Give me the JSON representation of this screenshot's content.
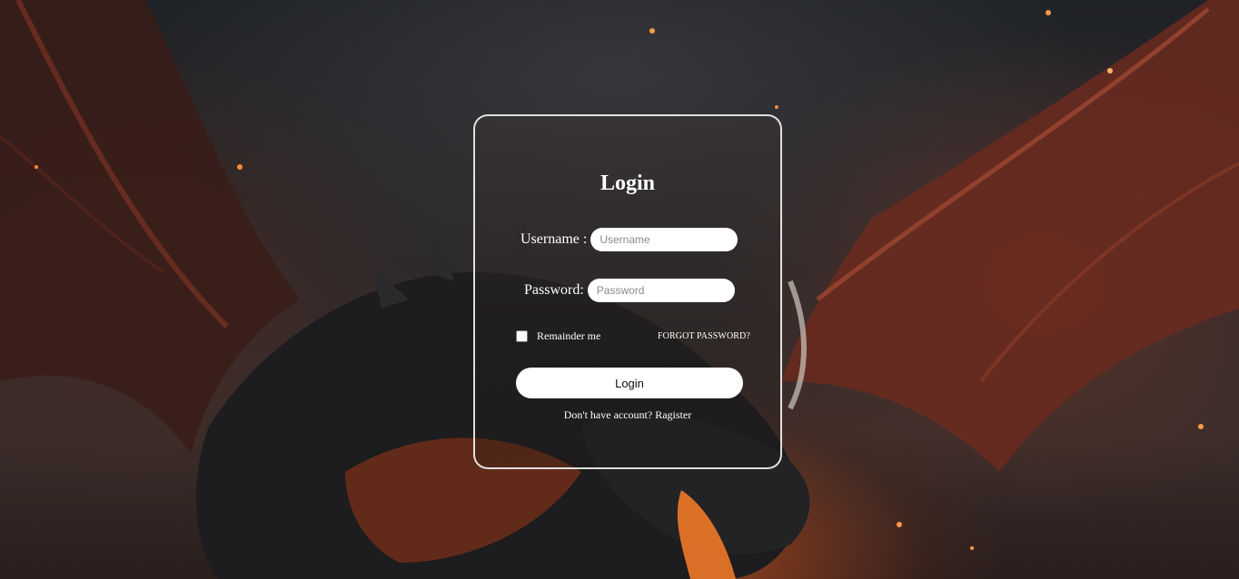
{
  "login_form": {
    "title": "Login",
    "username_label": "Username :",
    "username_placeholder": "Username",
    "username_value": "",
    "password_label": "Password:",
    "password_placeholder": "Password",
    "password_value": "",
    "remember_label": "Remainder me",
    "remember_checked": false,
    "forgot_password_link": "FORGOT PASSWORD?",
    "submit_label": "Login",
    "register_prompt": "Don't have account?",
    "register_link": "Ragister"
  },
  "background": {
    "subject": "dragon-artwork",
    "palette": {
      "sky": "#2c2a2b",
      "fire": "#e2551e",
      "wing": "#8a3526",
      "scales": "#1b1b1d"
    }
  }
}
